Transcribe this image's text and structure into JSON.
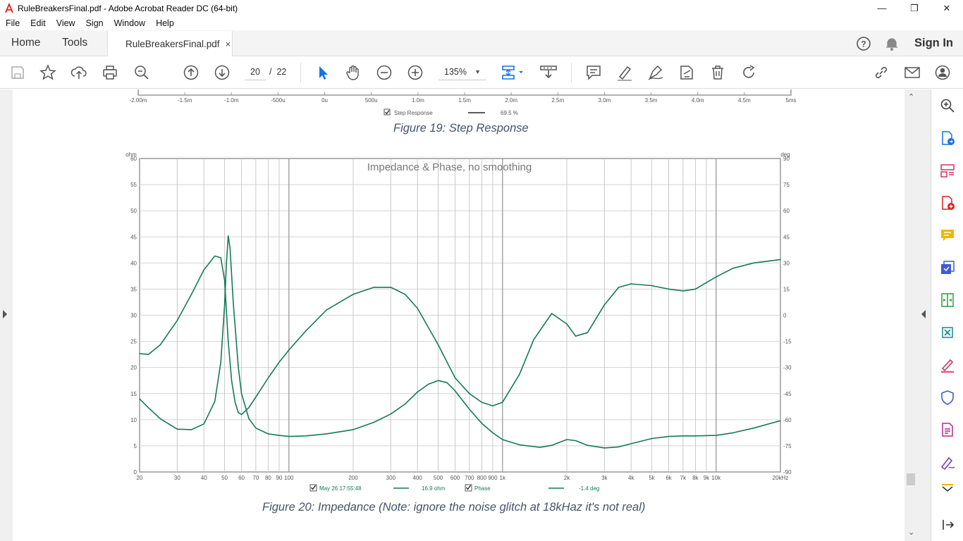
{
  "window": {
    "title": "RuleBreakersFinal.pdf - Adobe Acrobat Reader DC (64-bit)",
    "minimize": "—",
    "restore": "❐",
    "close": "✕"
  },
  "menu": [
    "File",
    "Edit",
    "View",
    "Sign",
    "Window",
    "Help"
  ],
  "tabs": {
    "home": "Home",
    "tools": "Tools",
    "doc": "RuleBreakersFinal.pdf",
    "close": "×",
    "signin": "Sign In"
  },
  "toolbar": {
    "page_current": "20",
    "page_sep": "/",
    "page_total": "22",
    "zoom": "135%"
  },
  "icons": {
    "save": "save-icon",
    "bookmark": "star-icon",
    "upload": "upload-icon",
    "print": "print-icon",
    "search": "zoom-search-icon",
    "page_up": "arrow-up-circle-icon",
    "page_down": "arrow-down-circle-icon",
    "select": "cursor-icon",
    "hand": "hand-icon",
    "zoom_out": "minus-circle-icon",
    "zoom_in": "plus-circle-icon",
    "fit": "fit-page-icon",
    "scroll": "scroll-mode-icon",
    "comment": "comment-icon",
    "highlight": "highlight-pen-icon",
    "draw": "draw-icon",
    "stamp": "stamp-icon",
    "delete": "trash-icon",
    "rotate": "rotate-icon",
    "link": "link-icon",
    "mail": "mail-icon",
    "account": "account-icon",
    "help": "help-icon",
    "bell": "bell-icon"
  },
  "colors": {
    "accent": "#1473e6",
    "curve": "#157a55",
    "caption": "#44546a"
  },
  "step_figure": {
    "x_ticks": [
      "-2.00m",
      "-1.5m",
      "-1.0m",
      "-500u",
      "0u",
      "500u",
      "1.0m",
      "1.5m",
      "2.0m",
      "2.5m",
      "3.0m",
      "3.5m",
      "4.0m",
      "4.5m",
      "5ms"
    ],
    "legend_label": "Step Response",
    "legend_value": "69.5 %",
    "caption": "Figure 19: Step Response"
  },
  "chart_data": {
    "type": "line",
    "title": "Impedance & Phase, no smoothing",
    "xscale": "log",
    "xlim": [
      20,
      20000
    ],
    "ylim": [
      0,
      60
    ],
    "y2lim": [
      -90,
      90
    ],
    "ylabel": "ohm",
    "y2label": "deg",
    "grid": true,
    "x_tick_labels": [
      "20",
      "30",
      "40",
      "50",
      "60",
      "70",
      "80",
      "90",
      "100",
      "200",
      "300",
      "400",
      "500",
      "600",
      "700",
      "800",
      "900",
      "1k",
      "2k",
      "3k",
      "4k",
      "5k",
      "6k",
      "7k",
      "8k",
      "9k",
      "10k",
      "20kHz"
    ],
    "y_tick_labels": [
      "0",
      "5",
      "10",
      "15",
      "20",
      "25",
      "30",
      "35",
      "40",
      "45",
      "50",
      "55",
      "60"
    ],
    "y2_tick_labels": [
      "-90",
      "-75",
      "-60",
      "-45",
      "-30",
      "-15",
      "0",
      "15",
      "30",
      "45",
      "60",
      "75",
      "90"
    ],
    "series": [
      {
        "name": "May 26 17:55:48",
        "axis": "left",
        "unit": "ohm",
        "x": [
          20,
          22,
          25,
          30,
          35,
          40,
          45,
          48,
          50,
          51,
          52,
          53,
          55,
          58,
          60,
          65,
          70,
          80,
          90,
          100,
          120,
          150,
          200,
          250,
          300,
          350,
          400,
          450,
          500,
          550,
          600,
          700,
          800,
          900,
          1000,
          1200,
          1500,
          1700,
          2000,
          2200,
          2500,
          3000,
          3500,
          4000,
          5000,
          6000,
          7000,
          8000,
          10000,
          12000,
          15000,
          18000,
          20000
        ],
        "y": [
          14,
          12.3,
          10.2,
          8.2,
          8.1,
          9.2,
          13.5,
          21,
          32,
          40,
          45.2,
          43,
          32,
          20,
          15,
          10.2,
          8.4,
          7.3,
          7,
          6.8,
          6.9,
          7.3,
          8.1,
          9.5,
          11.1,
          13,
          15.3,
          16.8,
          17.5,
          17.1,
          15.5,
          12,
          9.3,
          7.5,
          6.2,
          5.2,
          4.7,
          5.1,
          6.2,
          6,
          5.1,
          4.6,
          4.8,
          5.4,
          6.4,
          6.8,
          6.9,
          6.9,
          7,
          7.5,
          8.4,
          9.3,
          9.8
        ]
      },
      {
        "name": "Phase",
        "axis": "right",
        "unit": "deg",
        "x": [
          20,
          22,
          25,
          30,
          35,
          40,
          45,
          48,
          50,
          52,
          54,
          56,
          58,
          60,
          65,
          70,
          80,
          90,
          100,
          120,
          150,
          200,
          250,
          300,
          350,
          400,
          500,
          600,
          700,
          800,
          900,
          1000,
          1200,
          1400,
          1700,
          2000,
          2200,
          2500,
          3000,
          3500,
          4000,
          5000,
          6000,
          7000,
          8000,
          10000,
          12000,
          15000,
          20000
        ],
        "y": [
          -22,
          -22.5,
          -17,
          -3,
          12,
          26,
          34,
          33,
          20,
          -15,
          -38,
          -50,
          -56,
          -57,
          -53,
          -47,
          -36,
          -27,
          -20,
          -9,
          3,
          12,
          16,
          16,
          12,
          4,
          -17,
          -36,
          -45,
          -50,
          -52,
          -50,
          -34,
          -14,
          1,
          -5,
          -12,
          -10,
          6,
          16,
          18,
          17,
          15,
          14,
          15,
          22,
          27,
          30,
          32
        ]
      }
    ],
    "legend": [
      {
        "checked": true,
        "label": "May 26 17:55:48",
        "value": "16.9 ohm"
      },
      {
        "checked": true,
        "label": "Phase",
        "value": "-1.4 deg"
      }
    ]
  },
  "captions": {
    "fig20": "Figure 20: Impedance (Note: ignore the noise glitch at 18kHaz it's not real)"
  },
  "rightpanel": [
    "search-zoom-icon",
    "export-pdf-icon",
    "organize-pages-icon",
    "create-pdf-icon",
    "comment-tool-icon",
    "combine-files-icon",
    "compress-icon",
    "edit-pdf-icon",
    "protect-icon",
    "fill-sign-icon",
    "sign-icon",
    "more-tools-icon",
    "collapse-panel-icon"
  ]
}
